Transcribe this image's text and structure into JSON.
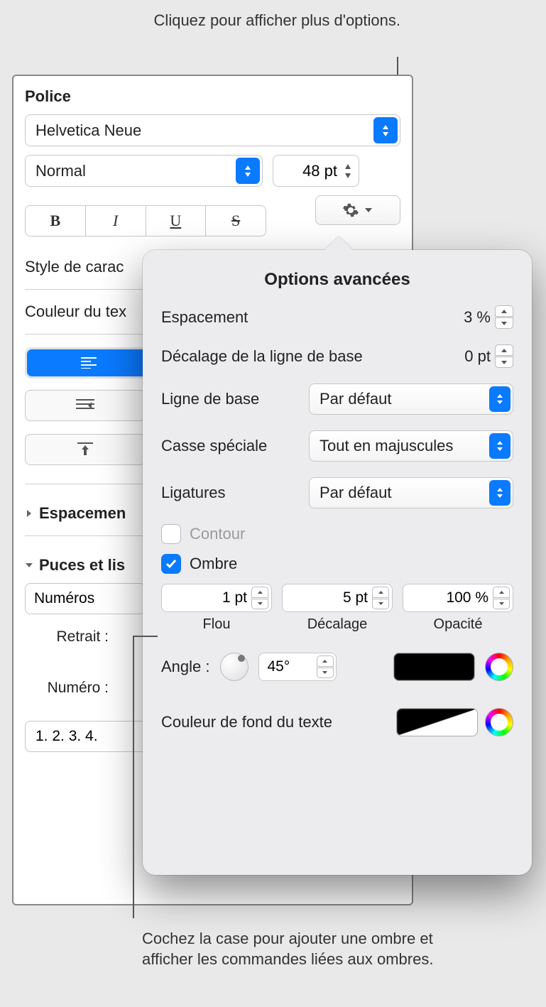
{
  "callouts": {
    "top": "Cliquez pour afficher plus d'options.",
    "bottom": "Cochez la case pour ajouter une ombre et afficher les commandes liées aux ombres."
  },
  "panel": {
    "police_title": "Police",
    "font_family": "Helvetica Neue",
    "font_style": "Normal",
    "font_size": "48 pt",
    "char_style_label": "Style de carac",
    "color_label": "Couleur du tex",
    "spacing_header": "Espacemen",
    "lists_header": "Puces et lis",
    "list_type": "Numéros",
    "indent_label": "Retrait :",
    "number_label": "Numéro :",
    "list_format": "1. 2. 3. 4."
  },
  "popover": {
    "title": "Options avancées",
    "spacing": {
      "label": "Espacement",
      "value": "3 %"
    },
    "baseline_offset": {
      "label": "Décalage de la ligne de base",
      "value": "0 pt"
    },
    "baseline": {
      "label": "Ligne de base",
      "value": "Par défaut"
    },
    "case": {
      "label": "Casse spéciale",
      "value": "Tout en majuscules"
    },
    "ligatures": {
      "label": "Ligatures",
      "value": "Par défaut"
    },
    "outline_label": "Contour",
    "shadow_label": "Ombre",
    "shadow": {
      "blur": {
        "value": "1 pt",
        "label": "Flou"
      },
      "offset": {
        "value": "5 pt",
        "label": "Décalage"
      },
      "opacity": {
        "value": "100 %",
        "label": "Opacité"
      },
      "angle_label": "Angle :",
      "angle_value": "45°"
    },
    "bg_label": "Couleur de fond du texte"
  }
}
